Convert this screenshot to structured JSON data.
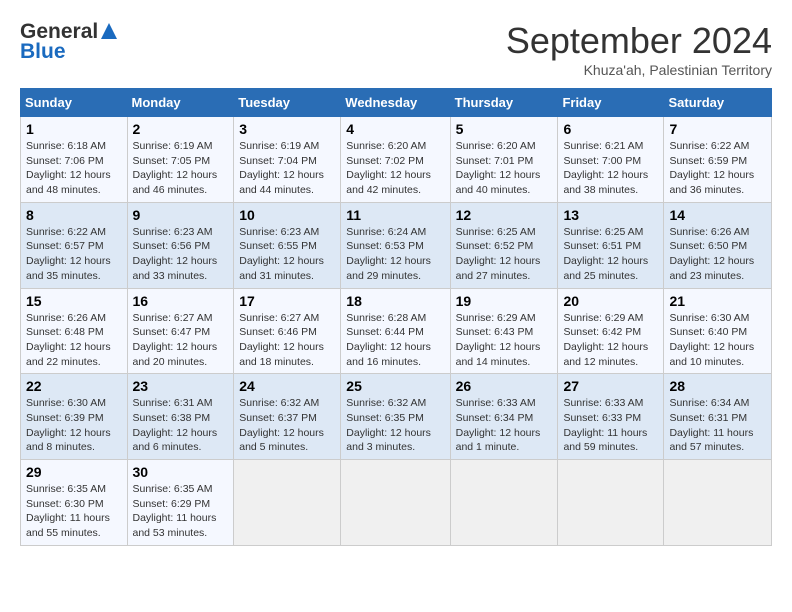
{
  "header": {
    "logo_general": "General",
    "logo_blue": "Blue",
    "month_title": "September 2024",
    "location": "Khuza'ah, Palestinian Territory"
  },
  "calendar": {
    "days_of_week": [
      "Sunday",
      "Monday",
      "Tuesday",
      "Wednesday",
      "Thursday",
      "Friday",
      "Saturday"
    ],
    "weeks": [
      [
        {
          "day": "1",
          "info": "Sunrise: 6:18 AM\nSunset: 7:06 PM\nDaylight: 12 hours\nand 48 minutes."
        },
        {
          "day": "2",
          "info": "Sunrise: 6:19 AM\nSunset: 7:05 PM\nDaylight: 12 hours\nand 46 minutes."
        },
        {
          "day": "3",
          "info": "Sunrise: 6:19 AM\nSunset: 7:04 PM\nDaylight: 12 hours\nand 44 minutes."
        },
        {
          "day": "4",
          "info": "Sunrise: 6:20 AM\nSunset: 7:02 PM\nDaylight: 12 hours\nand 42 minutes."
        },
        {
          "day": "5",
          "info": "Sunrise: 6:20 AM\nSunset: 7:01 PM\nDaylight: 12 hours\nand 40 minutes."
        },
        {
          "day": "6",
          "info": "Sunrise: 6:21 AM\nSunset: 7:00 PM\nDaylight: 12 hours\nand 38 minutes."
        },
        {
          "day": "7",
          "info": "Sunrise: 6:22 AM\nSunset: 6:59 PM\nDaylight: 12 hours\nand 36 minutes."
        }
      ],
      [
        {
          "day": "8",
          "info": "Sunrise: 6:22 AM\nSunset: 6:57 PM\nDaylight: 12 hours\nand 35 minutes."
        },
        {
          "day": "9",
          "info": "Sunrise: 6:23 AM\nSunset: 6:56 PM\nDaylight: 12 hours\nand 33 minutes."
        },
        {
          "day": "10",
          "info": "Sunrise: 6:23 AM\nSunset: 6:55 PM\nDaylight: 12 hours\nand 31 minutes."
        },
        {
          "day": "11",
          "info": "Sunrise: 6:24 AM\nSunset: 6:53 PM\nDaylight: 12 hours\nand 29 minutes."
        },
        {
          "day": "12",
          "info": "Sunrise: 6:25 AM\nSunset: 6:52 PM\nDaylight: 12 hours\nand 27 minutes."
        },
        {
          "day": "13",
          "info": "Sunrise: 6:25 AM\nSunset: 6:51 PM\nDaylight: 12 hours\nand 25 minutes."
        },
        {
          "day": "14",
          "info": "Sunrise: 6:26 AM\nSunset: 6:50 PM\nDaylight: 12 hours\nand 23 minutes."
        }
      ],
      [
        {
          "day": "15",
          "info": "Sunrise: 6:26 AM\nSunset: 6:48 PM\nDaylight: 12 hours\nand 22 minutes."
        },
        {
          "day": "16",
          "info": "Sunrise: 6:27 AM\nSunset: 6:47 PM\nDaylight: 12 hours\nand 20 minutes."
        },
        {
          "day": "17",
          "info": "Sunrise: 6:27 AM\nSunset: 6:46 PM\nDaylight: 12 hours\nand 18 minutes."
        },
        {
          "day": "18",
          "info": "Sunrise: 6:28 AM\nSunset: 6:44 PM\nDaylight: 12 hours\nand 16 minutes."
        },
        {
          "day": "19",
          "info": "Sunrise: 6:29 AM\nSunset: 6:43 PM\nDaylight: 12 hours\nand 14 minutes."
        },
        {
          "day": "20",
          "info": "Sunrise: 6:29 AM\nSunset: 6:42 PM\nDaylight: 12 hours\nand 12 minutes."
        },
        {
          "day": "21",
          "info": "Sunrise: 6:30 AM\nSunset: 6:40 PM\nDaylight: 12 hours\nand 10 minutes."
        }
      ],
      [
        {
          "day": "22",
          "info": "Sunrise: 6:30 AM\nSunset: 6:39 PM\nDaylight: 12 hours\nand 8 minutes."
        },
        {
          "day": "23",
          "info": "Sunrise: 6:31 AM\nSunset: 6:38 PM\nDaylight: 12 hours\nand 6 minutes."
        },
        {
          "day": "24",
          "info": "Sunrise: 6:32 AM\nSunset: 6:37 PM\nDaylight: 12 hours\nand 5 minutes."
        },
        {
          "day": "25",
          "info": "Sunrise: 6:32 AM\nSunset: 6:35 PM\nDaylight: 12 hours\nand 3 minutes."
        },
        {
          "day": "26",
          "info": "Sunrise: 6:33 AM\nSunset: 6:34 PM\nDaylight: 12 hours\nand 1 minute."
        },
        {
          "day": "27",
          "info": "Sunrise: 6:33 AM\nSunset: 6:33 PM\nDaylight: 11 hours\nand 59 minutes."
        },
        {
          "day": "28",
          "info": "Sunrise: 6:34 AM\nSunset: 6:31 PM\nDaylight: 11 hours\nand 57 minutes."
        }
      ],
      [
        {
          "day": "29",
          "info": "Sunrise: 6:35 AM\nSunset: 6:30 PM\nDaylight: 11 hours\nand 55 minutes."
        },
        {
          "day": "30",
          "info": "Sunrise: 6:35 AM\nSunset: 6:29 PM\nDaylight: 11 hours\nand 53 minutes."
        },
        {
          "day": "",
          "info": ""
        },
        {
          "day": "",
          "info": ""
        },
        {
          "day": "",
          "info": ""
        },
        {
          "day": "",
          "info": ""
        },
        {
          "day": "",
          "info": ""
        }
      ]
    ]
  }
}
